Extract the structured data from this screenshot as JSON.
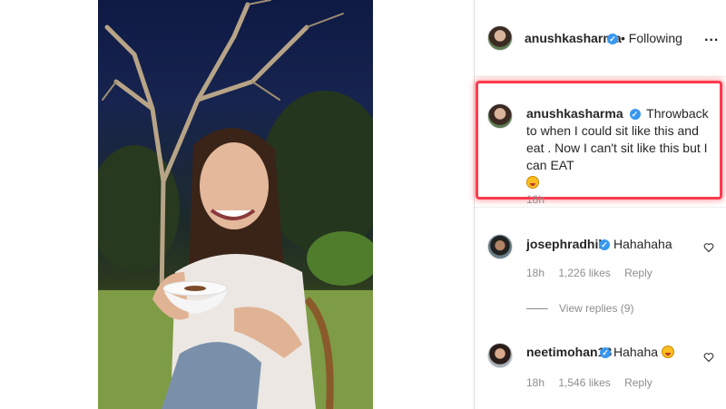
{
  "post": {
    "author": "anushkasharma",
    "follow_status": "• Following",
    "more": "..."
  },
  "caption": {
    "username": "anushkasharma",
    "text": "Throwback to when I could sit like this and eat . Now I can't sit like this but I can EAT",
    "emoji": "crazy-face-emoji",
    "time": "18h",
    "highlight_color": "#ff3b4f"
  },
  "comments": [
    {
      "username": "josephradhik",
      "text": "Hahahaha",
      "time": "18h",
      "likes": "1,226 likes",
      "reply": "Reply",
      "view_replies": "View replies (9)"
    },
    {
      "username": "neetimohan18",
      "text": "Hahaha",
      "emoji": "crazy-face-emoji",
      "time": "18h",
      "likes": "1,546 likes",
      "reply": "Reply"
    }
  ],
  "icons": {
    "verified": "verified-badge-icon",
    "heart": "heart-icon",
    "more": "more-options-icon"
  },
  "colors": {
    "verified_blue": "#3897f0",
    "secondary_text": "#8e8e8e"
  }
}
